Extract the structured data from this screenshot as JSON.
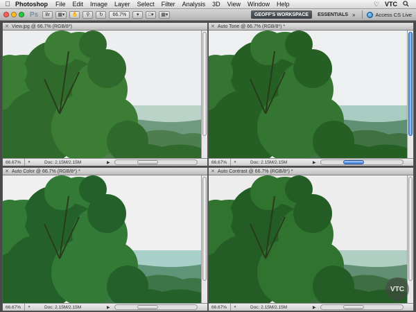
{
  "menubar": {
    "app_name": "Photoshop",
    "items": [
      "File",
      "Edit",
      "Image",
      "Layer",
      "Select",
      "Filter",
      "Analysis",
      "3D",
      "View",
      "Window",
      "Help"
    ],
    "right_label": "VTC"
  },
  "appbar": {
    "logo": "Ps",
    "zoom": "66.7%",
    "workspace": "GEOFF'S WORKSPACE",
    "essentials": "ESSENTIALS",
    "more": "»",
    "cs_live": "Access CS Live"
  },
  "colors": {
    "close": "#ff5f57",
    "minimize": "#ffbd2e",
    "maximize": "#28c940",
    "accent_blue": "#3f7bd0"
  },
  "documents": [
    {
      "title": "View.jpg @ 66.7% (RGB/8*)",
      "zoom": "66.67%",
      "doc": "Doc: 2.15M/2.15M",
      "tone": "orig"
    },
    {
      "title": "Auto Tone @ 66.7% (RGB/8*) *",
      "zoom": "66.67%",
      "doc": "Doc: 2.15M/2.15M",
      "tone": "tone"
    },
    {
      "title": "Auto Color @ 66.7% (RGB/8*) *",
      "zoom": "66.67%",
      "doc": "Doc: 2.15M/2.15M",
      "tone": "color"
    },
    {
      "title": "Auto Contrast @ 66.7% (RGB/8*) *",
      "zoom": "66.67%",
      "doc": "Doc: 2.15M/2.15M",
      "tone": "contrast"
    }
  ],
  "watermark": "VTC"
}
